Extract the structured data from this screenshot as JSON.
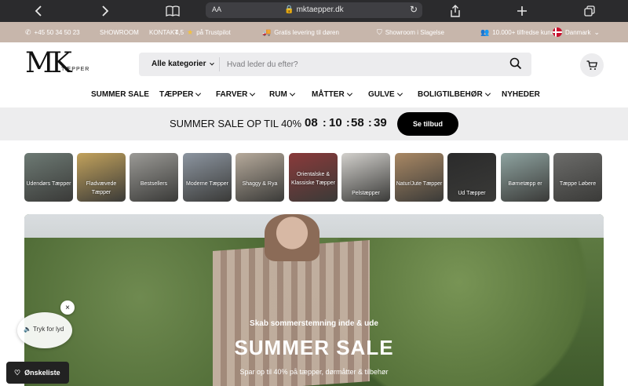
{
  "browser": {
    "back_icon": "chevron-left-icon",
    "forward_icon": "chevron-right-icon",
    "reader_icon": "book-icon",
    "aa": "AA",
    "url": "mktaepper.dk",
    "share_icon": "share-icon",
    "newtab_icon": "plus-icon",
    "tabs_icon": "tabs-icon"
  },
  "topbar": {
    "phone": "+45 50 34 50 23",
    "showroom": "SHOWROOM",
    "kontakt": "KONTAKT",
    "rating": "4,5",
    "trustpilot": "på Trustpilot",
    "delivery": "Gratis levering til døren",
    "showroom_location": "Showroom i Slagelse",
    "customers": "10.000+ tilfredse kunder",
    "country": "Danmark",
    "colors": {
      "bg": "#c7b6ab"
    }
  },
  "header": {
    "logo_mark": "MK",
    "logo_word": "TÆPPER",
    "search_category": "Alle kategorier",
    "search_placeholder": "Hvad leder du efter?"
  },
  "nav": {
    "items": [
      {
        "label": "SUMMER SALE",
        "dropdown": false
      },
      {
        "label": "TÆPPER",
        "dropdown": true
      },
      {
        "label": "FARVER",
        "dropdown": true
      },
      {
        "label": "RUM",
        "dropdown": true
      },
      {
        "label": "MÅTTER",
        "dropdown": true
      },
      {
        "label": "GULVE",
        "dropdown": true
      },
      {
        "label": "BOLIGTILBEHØR",
        "dropdown": true
      },
      {
        "label": "NYHEDER",
        "dropdown": false
      }
    ]
  },
  "promo": {
    "text": "SUMMER SALE OP TIL 40%",
    "countdown": [
      "08",
      "10",
      "58",
      "39"
    ],
    "separator": ":",
    "button": "Se tilbud"
  },
  "categories": [
    {
      "label": "Udendørs Tæpper",
      "color": "#6d7a74"
    },
    {
      "label": "Fladvævede Tæpper",
      "color": "#c2a25c"
    },
    {
      "label": "Bestsellers",
      "color": "#9b9a96"
    },
    {
      "label": "Moderne Tæpper",
      "color": "#8c95a0"
    },
    {
      "label": "Shaggy & Rya",
      "color": "#b6aa9b"
    },
    {
      "label": "Orientalske & Klassiske Tæpper",
      "color": "#8a3a3a"
    },
    {
      "label": "Pelstæpper",
      "color": "#d2d0cc"
    },
    {
      "label": "Natur/Jute Tæpper",
      "color": "#a98864"
    },
    {
      "label": "Ud Tæpper",
      "color": "#2b2b2b"
    },
    {
      "label": "Børnetæpp er",
      "color": "#8ea3a0"
    },
    {
      "label": "Tæppe Løbere",
      "color": "#6c6c6a"
    }
  ],
  "hero": {
    "subtitle": "Skab sommerstemning inde & ude",
    "title": "SUMMER SALE",
    "description": "Spar op til 40% på tæpper, dørmåtter & tilbehør"
  },
  "widgets": {
    "sound_label": "Tryk for lyd",
    "close": "×",
    "wishlist": "Ønskeliste"
  }
}
